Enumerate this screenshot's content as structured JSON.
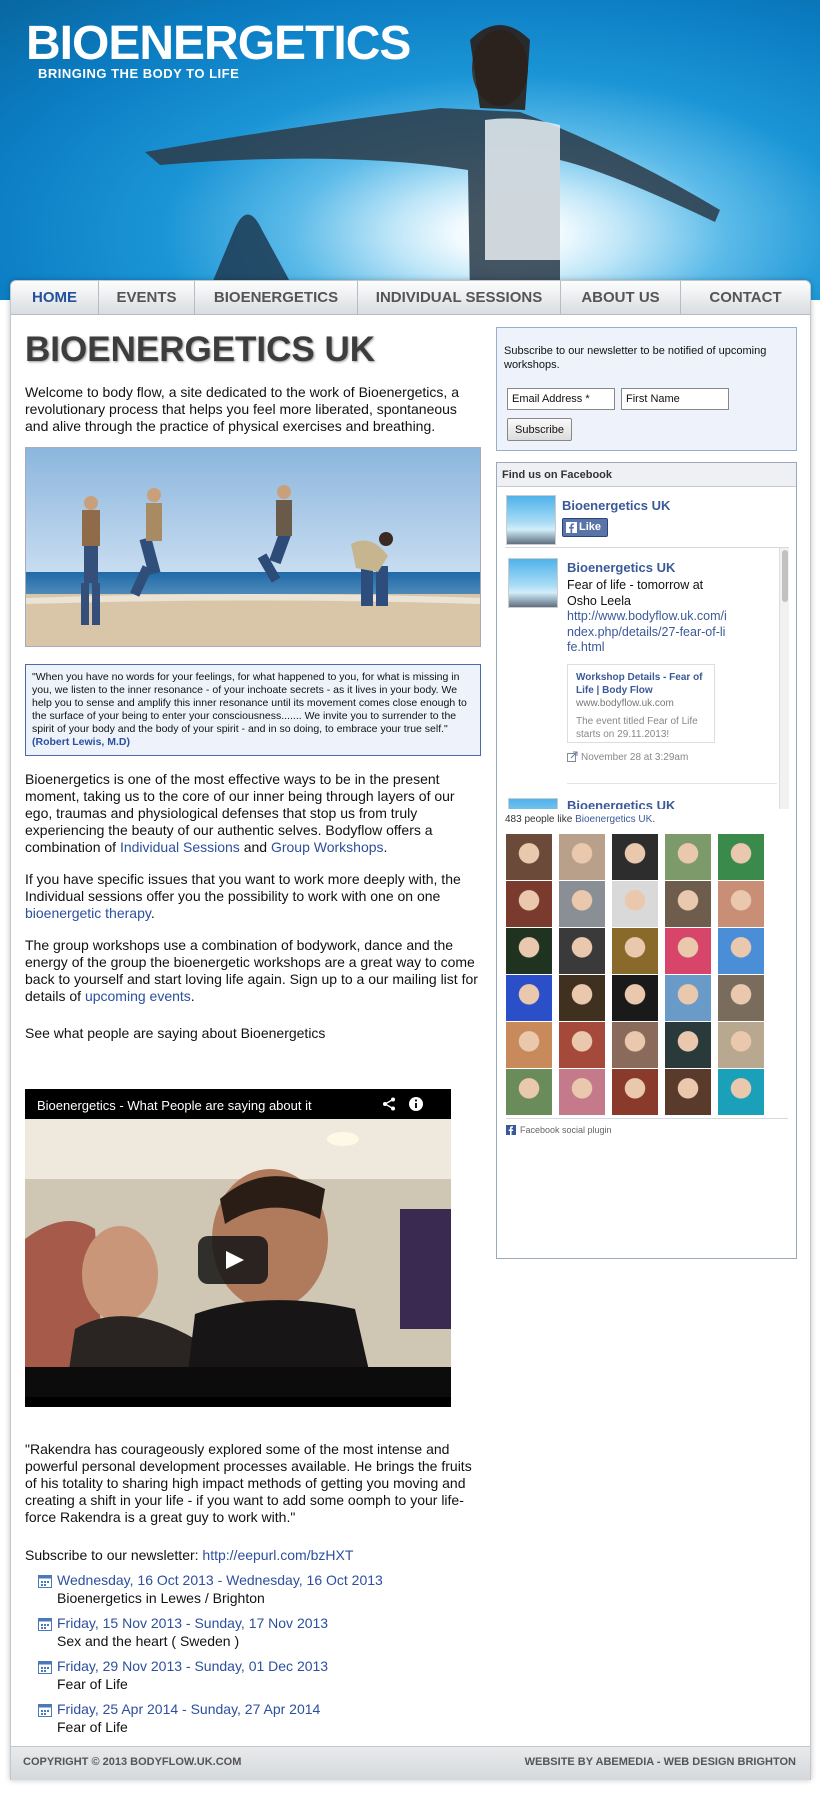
{
  "header": {
    "logo": "BIOENERGETICS",
    "tagline": "BRINGING THE BODY TO LIFE"
  },
  "nav": [
    {
      "label": "HOME",
      "active": true
    },
    {
      "label": "EVENTS"
    },
    {
      "label": "BIOENERGETICS"
    },
    {
      "label": "INDIVIDUAL SESSIONS"
    },
    {
      "label": "ABOUT US"
    },
    {
      "label": "CONTACT"
    }
  ],
  "main": {
    "title": "BIOENERGETICS UK",
    "intro": "Welcome to body flow, a site dedicated to the work of Bioenergetics, a revolutionary process that helps you feel more liberated, spontaneous and alive through the practice of physical exercises and breathing.",
    "quote": "\"When you have no words for your feelings, for what happened to you, for what is missing in you, we listen to the inner resonance - of your inchoate secrets - as it lives in your body. We help you to sense and amplify this inner resonance until its movement comes close enough to the surface of your being to enter your consciousness....... We invite you to surrender to the spirit of your body and the body of your spirit - and in so doing, to embrace your true self.\"",
    "quote_author": "(Robert Lewis, M.D)",
    "para1_a": "Bioenergetics is one of the most effective ways to be in the present moment, taking us to the core of our inner being through layers of our ego, traumas and physiological defenses that stop us from truly experiencing the beauty of our authentic selves. Bodyflow offers a combination of ",
    "para1_link1": "Individual Sessions",
    "para1_b": " and ",
    "para1_link2": "Group Workshops",
    "para1_c": ".",
    "para2_a": "If you have specific issues that you want to work more deeply with, the Individual sessions offer you the possibility to work with one on one ",
    "para2_link": "bioenergetic therapy",
    "para2_b": ".",
    "para3_a": "The group workshops use a combination of bodywork, dance and the energy of the group the bioenergetic workshops are a great way to come back to yourself and start loving life again. Sign up to a our mailing list for details of ",
    "para3_link": "upcoming events",
    "para3_b": ".",
    "para4": "See what people are saying about Bioenergetics",
    "video_title": "Bioenergetics - What People are saying about it",
    "testimonial": "\"Rakendra has courageously explored some of the most intense and powerful personal development processes available. He brings the fruits of his totality to sharing high impact methods of getting you moving and creating a shift in your life - if you want to add some oomph to your life-force Rakendra is a great guy to work with.\"",
    "subscribe_label": "Subscribe to our newsletter: ",
    "subscribe_link": "http://eepurl.com/bzHXT",
    "events": [
      {
        "date": "Wednesday, 16 Oct 2013 - Wednesday, 16 Oct 2013",
        "name": "Bioenergetics in Lewes / Brighton"
      },
      {
        "date": "Friday, 15 Nov 2013 - Sunday, 17 Nov 2013",
        "name": "Sex and the heart ( Sweden )"
      },
      {
        "date": "Friday, 29 Nov 2013 - Sunday, 01 Dec 2013",
        "name": "Fear of Life"
      },
      {
        "date": "Friday, 25 Apr 2014 - Sunday, 27 Apr 2014",
        "name": "Fear of Life"
      }
    ]
  },
  "sidebar": {
    "newsletter_text": "Subscribe to our newsletter to be notified of upcoming workshops.",
    "email_placeholder": "Email Address *",
    "firstname_placeholder": "First Name",
    "subscribe_button": "Subscribe",
    "fb_header": "Find us on Facebook",
    "fb_page_name": "Bioenergetics UK",
    "fb_like": "Like",
    "post_author": "Bioenergetics UK",
    "post_text": "Fear of life - tomorrow at Osho Leela",
    "post_link": "http://www.bodyflow.uk.com/index.php/details/27-fear-of-life.html",
    "card_title": "Workshop Details - Fear of Life | Body Flow",
    "card_domain": "www.bodyflow.uk.com",
    "card_desc": "The event titled Fear of Life starts on 29.11.2013!",
    "post_time": "November 28 at 3:29am",
    "post2_author": "Bioenergetics UK",
    "likes_count": "483 people like ",
    "likes_page": "Bioenergetics UK",
    "likes_tail": ".",
    "plugin_label": "Facebook social plugin"
  },
  "footer": {
    "left": "COPYRIGHT © 2013 BODYFLOW.UK.COM",
    "right": "WEBSITE BY ABEMEDIA - WEB DESIGN BRIGHTON"
  },
  "colors": {
    "link": "#2c4f9e",
    "header_blue": "#0b7cc2",
    "fb_blue": "#3b5998"
  },
  "face_colors": [
    "#6b4a3a",
    "#b9a08a",
    "#2d2d2d",
    "#7c9a6a",
    "#3a8a4c",
    "#7a3a2e",
    "#8a8f96",
    "#d9d9d9",
    "#6e5c4c",
    "#c98e76",
    "#1f3320",
    "#3a3a3a",
    "#8a6a2a",
    "#d8456a",
    "#4a8ed8",
    "#2a4fc8",
    "#403020",
    "#1a1a1a",
    "#6a9ac8",
    "#7a6c5c",
    "#c88a5a",
    "#a54a3a",
    "#8a6a5a",
    "#2a3a3a",
    "#b8a890",
    "#6a8c5a",
    "#c47a8a",
    "#8a3a2a",
    "#5a3a2a",
    "#1aa0b8"
  ]
}
